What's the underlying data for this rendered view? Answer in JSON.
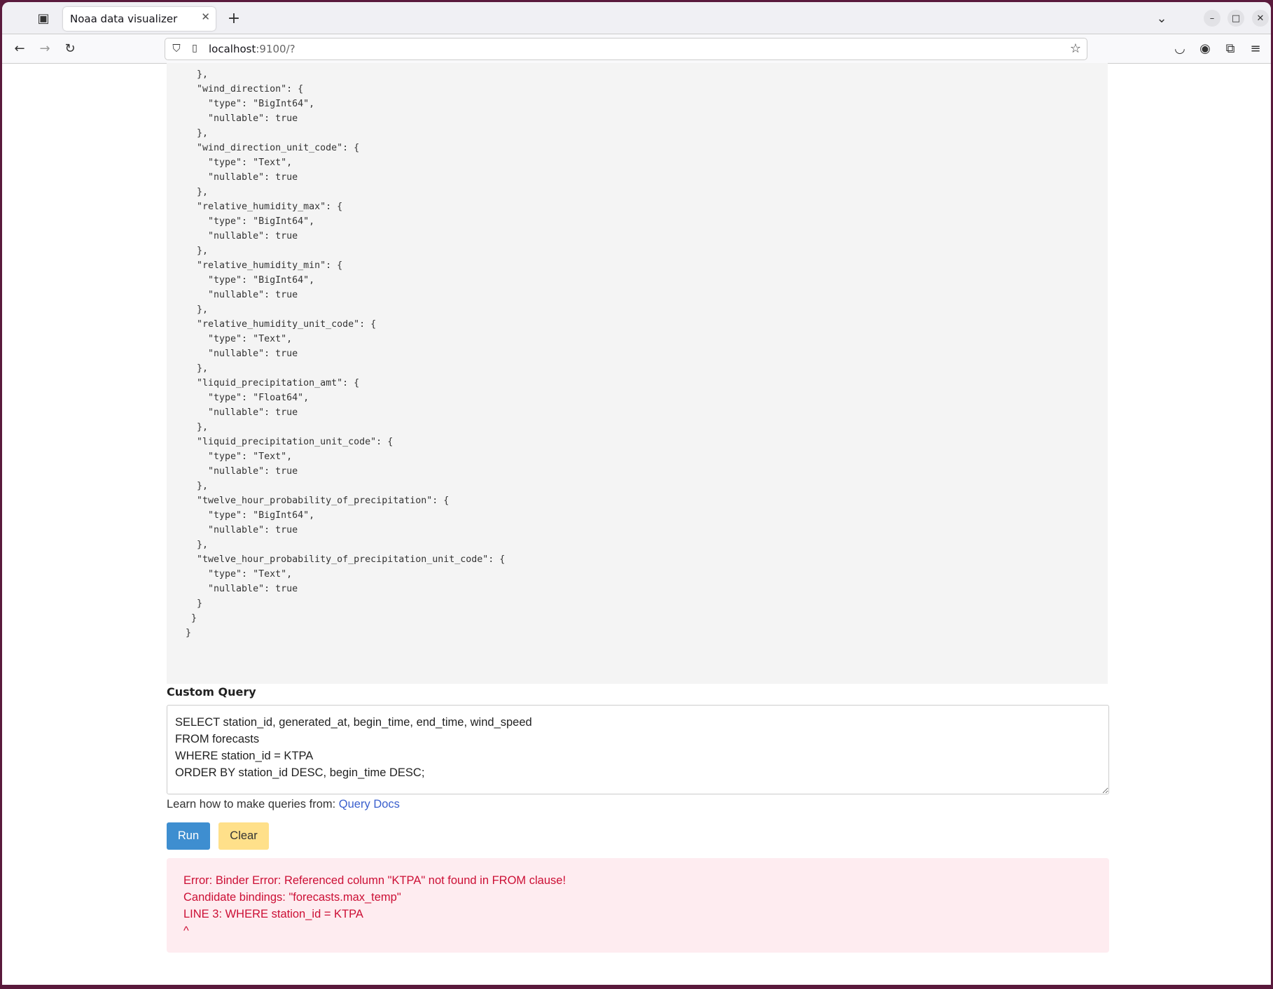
{
  "browser": {
    "tab_title": "Noaa data visualizer",
    "url_host": "localhost",
    "url_rest": ":9100/?"
  },
  "schema_lines": [
    "  },",
    "  \"wind_direction\": {",
    "    \"type\": \"BigInt64\",",
    "    \"nullable\": true",
    "  },",
    "  \"wind_direction_unit_code\": {",
    "    \"type\": \"Text\",",
    "    \"nullable\": true",
    "  },",
    "  \"relative_humidity_max\": {",
    "    \"type\": \"BigInt64\",",
    "    \"nullable\": true",
    "  },",
    "  \"relative_humidity_min\": {",
    "    \"type\": \"BigInt64\",",
    "    \"nullable\": true",
    "  },",
    "  \"relative_humidity_unit_code\": {",
    "    \"type\": \"Text\",",
    "    \"nullable\": true",
    "  },",
    "  \"liquid_precipitation_amt\": {",
    "    \"type\": \"Float64\",",
    "    \"nullable\": true",
    "  },",
    "  \"liquid_precipitation_unit_code\": {",
    "    \"type\": \"Text\",",
    "    \"nullable\": true",
    "  },",
    "  \"twelve_hour_probability_of_precipitation\": {",
    "    \"type\": \"BigInt64\",",
    "    \"nullable\": true",
    "  },",
    "  \"twelve_hour_probability_of_precipitation_unit_code\": {",
    "    \"type\": \"Text\",",
    "    \"nullable\": true",
    "  }",
    " }",
    "}"
  ],
  "query": {
    "label": "Custom Query",
    "value": "SELECT station_id, generated_at, begin_time, end_time, wind_speed\nFROM forecasts\nWHERE station_id = KTPA\nORDER BY station_id DESC, begin_time DESC;",
    "learn_text": "Learn how to make queries from: ",
    "docs_link": "Query Docs",
    "run_label": "Run",
    "clear_label": "Clear"
  },
  "error": {
    "lines": [
      "Error: Binder Error: Referenced column \"KTPA\" not found in FROM clause!",
      "Candidate bindings: \"forecasts.max_temp\"",
      "LINE 3: WHERE station_id = KTPA",
      "^"
    ]
  },
  "colors": {
    "run": "#3e8ed0",
    "clear": "#ffe08a",
    "error_bg": "#feecf0",
    "error_text": "#cc0f35",
    "link": "#3a5fcd"
  }
}
